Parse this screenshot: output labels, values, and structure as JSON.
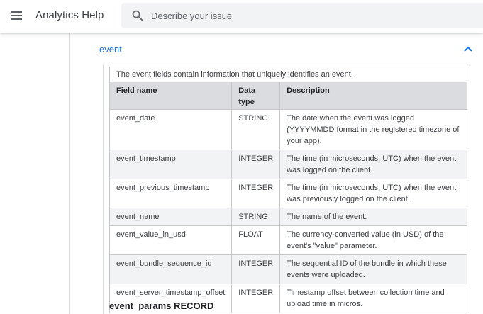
{
  "header": {
    "app_title": "Analytics Help",
    "search_placeholder": "Describe your issue"
  },
  "accordion": {
    "title": "event"
  },
  "table": {
    "caption": "The event fields contain information that uniquely identifies an event.",
    "columns": [
      "Field name",
      "Data type",
      "Description"
    ],
    "rows": [
      [
        "event_date",
        "STRING",
        "The date when the event was logged (YYYYMMDD format in the registered timezone of your app)."
      ],
      [
        "event_timestamp",
        "INTEGER",
        "The time (in microseconds, UTC) when the event was logged on the client."
      ],
      [
        "event_previous_timestamp",
        "INTEGER",
        "The time (in microseconds, UTC) when the event was previously logged on the client."
      ],
      [
        "event_name",
        "STRING",
        "The name of the event."
      ],
      [
        "event_value_in_usd",
        "FLOAT",
        "The currency-converted value (in USD) of the event's \"value\" parameter."
      ],
      [
        "event_bundle_sequence_id",
        "INTEGER",
        "The sequential ID of the bundle in which these events were uploaded."
      ],
      [
        "event_server_timestamp_offset",
        "INTEGER",
        "Timestamp offset between collection time and upload time in micros."
      ]
    ]
  },
  "next_section": {
    "heading": "event_params RECORD"
  },
  "colors": {
    "link_blue": "#1a73e8",
    "header_row_bg": "#dadce0",
    "alt_row_bg": "#f1f3f4",
    "search_bg": "#f1f3f4"
  },
  "icons": [
    "menu-icon",
    "search-icon",
    "chevron-up-icon"
  ]
}
